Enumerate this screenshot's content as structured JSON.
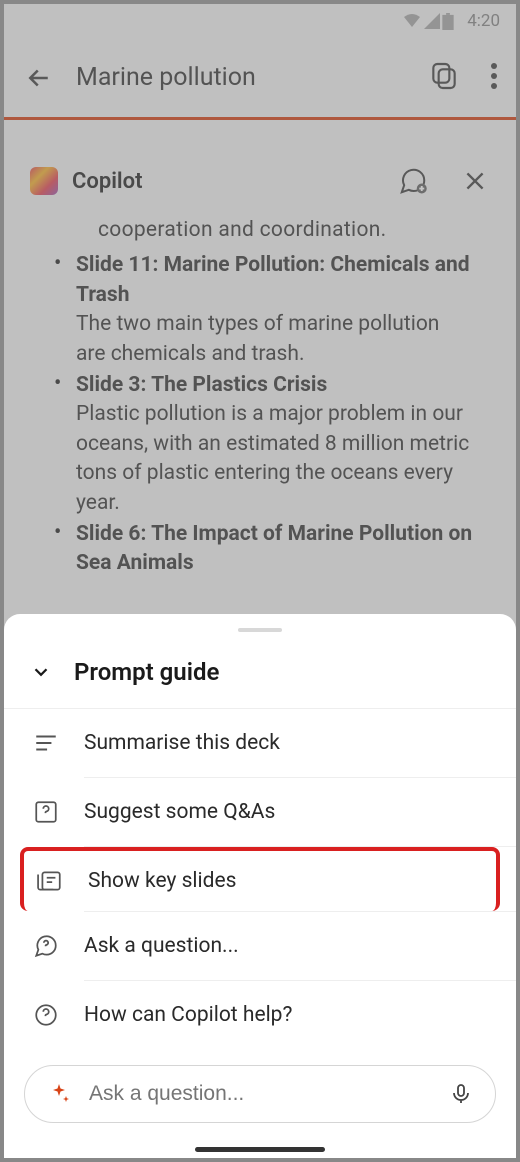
{
  "status": {
    "time": "4:20"
  },
  "header": {
    "title": "Marine pollution"
  },
  "copilot": {
    "title": "Copilot",
    "partial_line": "cooperation and coordination.",
    "slides": [
      {
        "title": "Slide 11: Marine Pollution: Chemicals and Trash",
        "desc": "The two main types of marine pollution are chemicals and trash."
      },
      {
        "title": "Slide 3: The Plastics Crisis",
        "desc": "Plastic pollution is a major problem in our oceans, with an estimated 8 million metric tons of plastic entering the oceans every year."
      },
      {
        "title": "Slide 6: The Impact of Marine Pollution on Sea Animals",
        "desc": ""
      }
    ]
  },
  "prompt_guide": {
    "title": "Prompt guide",
    "items": [
      {
        "label": "Summarise this deck"
      },
      {
        "label": "Suggest some Q&As"
      },
      {
        "label": "Show key slides"
      },
      {
        "label": "Ask a question..."
      },
      {
        "label": "How can Copilot help?"
      }
    ]
  },
  "input": {
    "placeholder": "Ask a question..."
  }
}
